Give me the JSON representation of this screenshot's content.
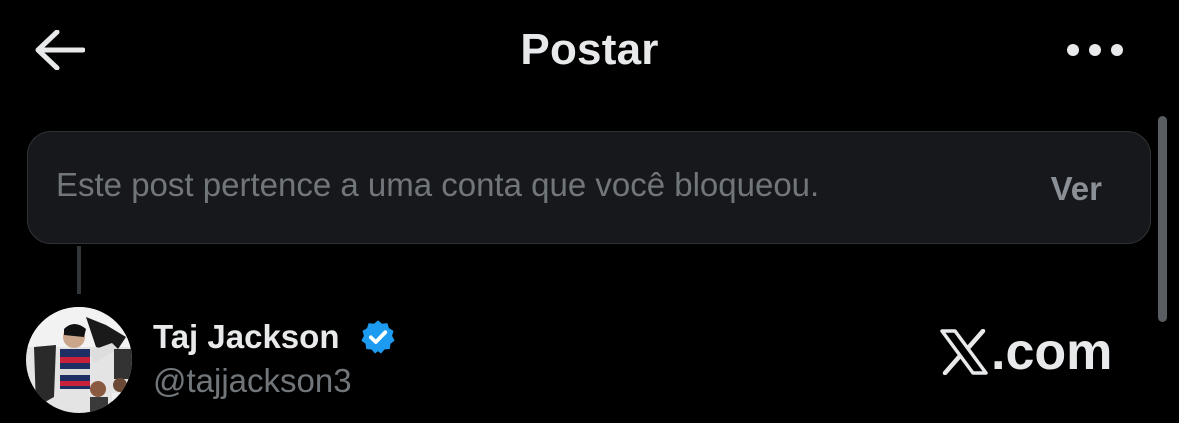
{
  "header": {
    "title": "Postar",
    "back_icon": "arrow-left-icon",
    "more_icon": "more-horizontal-icon"
  },
  "blocked_post": {
    "message": "Este post pertence a uma conta que você bloqueou.",
    "view_label": "Ver"
  },
  "author": {
    "name": "Taj Jackson",
    "handle": "@tajjackson3",
    "verified": true,
    "verified_color": "#1d9bf0"
  },
  "watermark": {
    "logo_icon": "x-logo-icon",
    "text": ".com"
  },
  "colors": {
    "background": "#000000",
    "primary_text": "#e7e9ea",
    "secondary_text": "#71767b",
    "card_background": "#17181c"
  }
}
